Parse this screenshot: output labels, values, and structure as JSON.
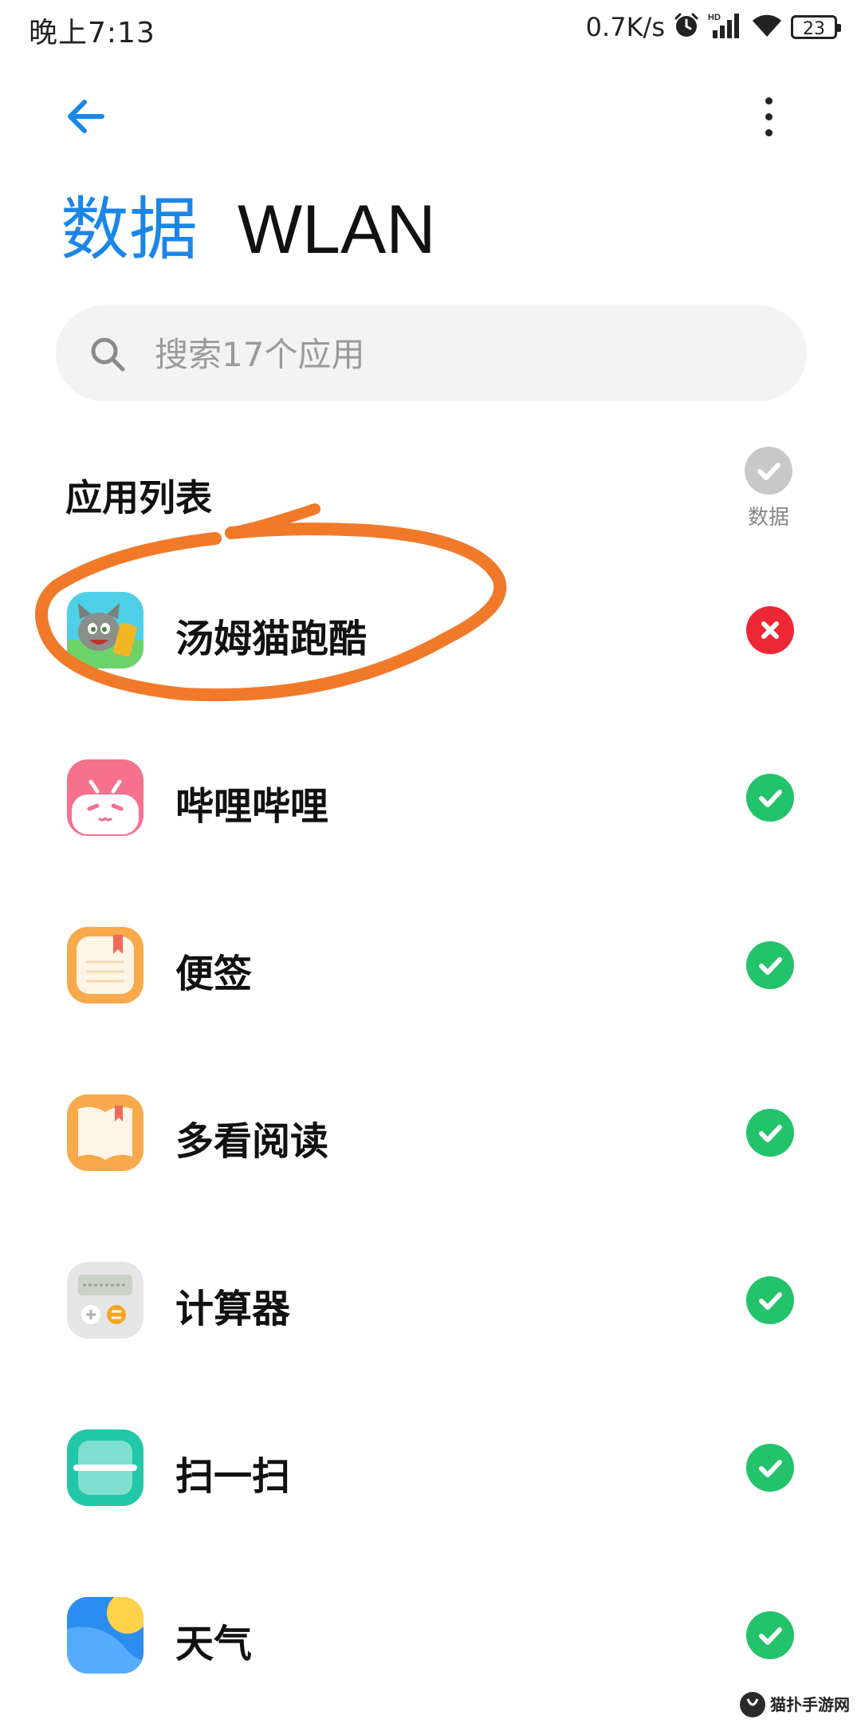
{
  "status_bar": {
    "time": "晚上7:13",
    "net_speed": "0.7K/s",
    "battery": "23",
    "icons": [
      "alarm-icon",
      "hd-signal-icon",
      "wifi-icon",
      "battery-icon"
    ]
  },
  "header": {
    "back_icon": "arrow-left-icon",
    "more_icon": "more-vertical-icon"
  },
  "tabs": [
    {
      "label": "数据",
      "active": true
    },
    {
      "label": "WLAN",
      "active": false
    }
  ],
  "search": {
    "placeholder": "搜索17个应用",
    "value": ""
  },
  "app_list": {
    "title": "应用列表",
    "column_label": "数据",
    "items": [
      {
        "name": "汤姆猫跑酷",
        "icon": "talking-tom-run-icon",
        "data_allowed": false
      },
      {
        "name": "哔哩哔哩",
        "icon": "bilibili-icon",
        "data_allowed": true
      },
      {
        "name": "便签",
        "icon": "notes-icon",
        "data_allowed": true
      },
      {
        "name": "多看阅读",
        "icon": "duokan-reader-icon",
        "data_allowed": true
      },
      {
        "name": "计算器",
        "icon": "calculator-icon",
        "data_allowed": true
      },
      {
        "name": "扫一扫",
        "icon": "scanner-icon",
        "data_allowed": true
      },
      {
        "name": "天气",
        "icon": "weather-icon",
        "data_allowed": true
      }
    ]
  },
  "colors": {
    "accent": "#1a86e8",
    "check_on": "#22c36b",
    "check_off": "#ee2735",
    "annotation": "#f07a2a"
  },
  "watermark": "猫扑手游网"
}
